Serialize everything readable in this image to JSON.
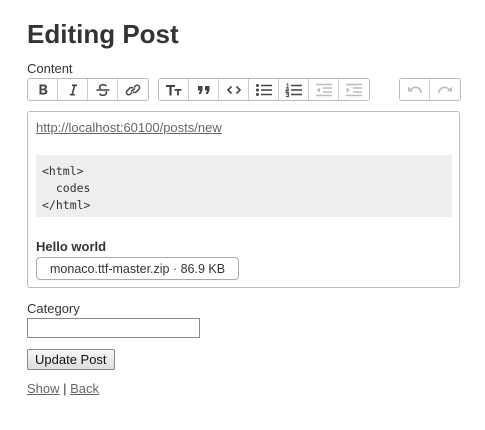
{
  "page": {
    "title": "Editing Post"
  },
  "form": {
    "content_label": "Content",
    "category_label": "Category",
    "category_value": "",
    "submit_label": "Update Post"
  },
  "toolbar": {
    "groups": [
      {
        "name": "text",
        "buttons": [
          {
            "icon": "bold-icon",
            "title": "Bold"
          },
          {
            "icon": "italic-icon",
            "title": "Italic"
          },
          {
            "icon": "strikethrough-icon",
            "title": "Strikethrough"
          },
          {
            "icon": "link-icon",
            "title": "Link"
          }
        ]
      },
      {
        "name": "block",
        "buttons": [
          {
            "icon": "heading-icon",
            "title": "Heading"
          },
          {
            "icon": "quote-icon",
            "title": "Quote"
          },
          {
            "icon": "code-icon",
            "title": "Code"
          },
          {
            "icon": "bullet-list-icon",
            "title": "Bullets"
          },
          {
            "icon": "numbered-list-icon",
            "title": "Numbers"
          },
          {
            "icon": "outdent-icon",
            "title": "Decrease Level",
            "disabled": true
          },
          {
            "icon": "indent-icon",
            "title": "Increase Level",
            "disabled": true
          }
        ]
      },
      {
        "name": "history",
        "buttons": [
          {
            "icon": "undo-icon",
            "title": "Undo",
            "disabled": true
          },
          {
            "icon": "redo-icon",
            "title": "Redo",
            "disabled": true
          }
        ]
      }
    ]
  },
  "editor": {
    "link_text": "http://localhost:60100/posts/new",
    "code_lines": [
      "<html>",
      "  codes",
      "</html>"
    ],
    "bold_text": "Hello world",
    "attachment": {
      "filename": "monaco.ttf-master.zip",
      "separator": " · ",
      "size": "86.9 KB"
    }
  },
  "footer": {
    "show_label": "Show",
    "separator": " | ",
    "back_label": "Back"
  },
  "colors": {
    "text": "#333333",
    "link": "#666666",
    "border": "#bbbbbb",
    "code_bg": "#eeeeee"
  }
}
